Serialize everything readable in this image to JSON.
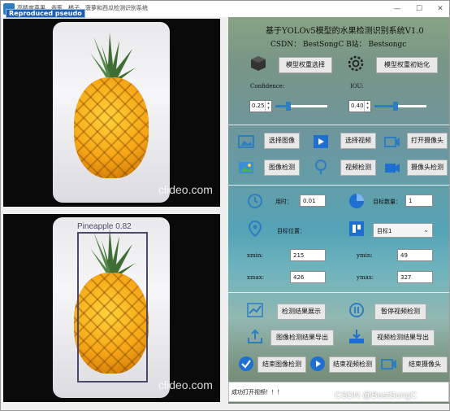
{
  "window": {
    "title": "高精度苹果、香蕉、橘子、菠萝和西瓜检测识别系统",
    "overlay_text": "Reproduced pseudo",
    "min_symbol": "—",
    "max_symbol": "☐",
    "close_symbol": "✕"
  },
  "images": {
    "watermark": "clideo.com",
    "detection_label": "Pineapple  0.82"
  },
  "header": {
    "title": "基于YOLOv5模型的水果检测识别系统V1.0",
    "subtitle": "CSDN：  BestSongC    B站：  Bestsongc"
  },
  "model": {
    "select_label": "模型权重选择",
    "init_label": "模型权重初始化"
  },
  "confidence": {
    "label": "Confidence:",
    "value": "0.25",
    "fraction": 0.25
  },
  "iou": {
    "label": "IOU:",
    "value": "0.40",
    "fraction": 0.4
  },
  "actions": {
    "select_image": "选择图像",
    "select_video": "选择视频",
    "open_camera": "打开摄像头",
    "image_detect": "图像检测",
    "video_detect": "视频检测",
    "camera_detect": "摄像头检测"
  },
  "stats": {
    "time_label": "用时：",
    "time_value": "0.01",
    "count_label": "目标数量：",
    "count_value": "1",
    "position_label": "目标位置：",
    "target_select": "目标1",
    "xmin_label": "xmin:",
    "xmin_value": "215",
    "ymin_label": "ymin:",
    "ymin_value": "49",
    "xmax_label": "xmax:",
    "xmax_value": "426",
    "ymax_label": "ymax:",
    "ymax_value": "327"
  },
  "results": {
    "show_results": "检测结果展示",
    "pause_video": "暂停视频检测",
    "export_image": "图像检测结果导出",
    "export_video": "视频检测结果导出",
    "end_image": "结束图像检测",
    "end_video": "结束视频检测",
    "end_camera": "结束摄像头"
  },
  "status": {
    "message": "成功打开视频！！！"
  },
  "footer_watermark": "CSDN @BestSongC",
  "colors": {
    "accent": "#2f7dc1",
    "title_bar": "#ffffff",
    "det_box": "#4a4a6a"
  }
}
